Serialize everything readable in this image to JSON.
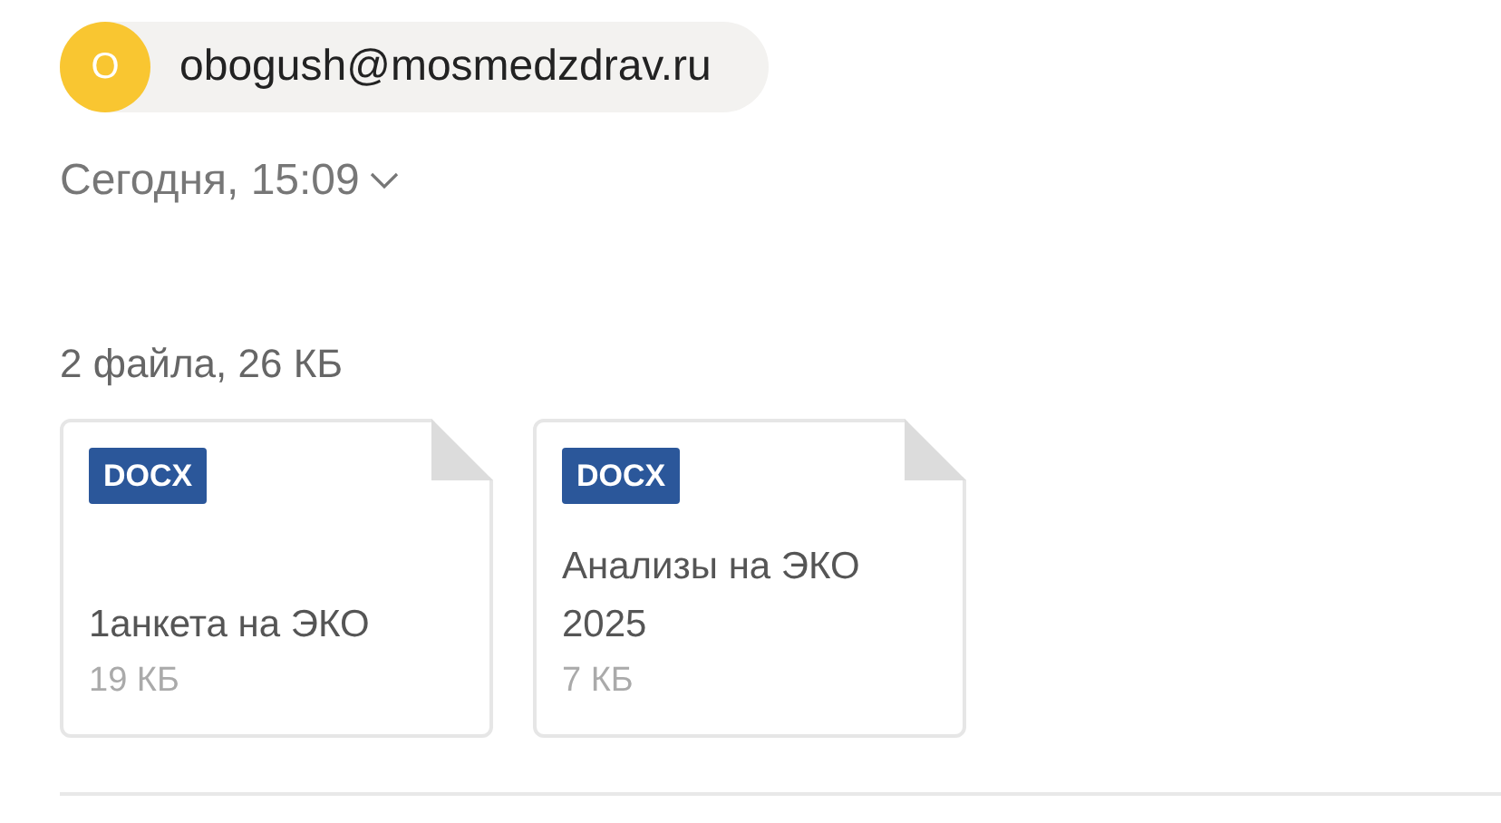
{
  "sender": {
    "initial": "O",
    "email": "obogush@mosmedzdrav.ru"
  },
  "date": "Сегодня, 15:09",
  "attachments": {
    "summary": "2 файла, 26 КБ",
    "files": [
      {
        "type": "DOCX",
        "name": "1анкета на ЭКО",
        "size": "19 КБ"
      },
      {
        "type": "DOCX",
        "name": "Анализы на ЭКО 2025",
        "size": "7 КБ"
      }
    ]
  }
}
